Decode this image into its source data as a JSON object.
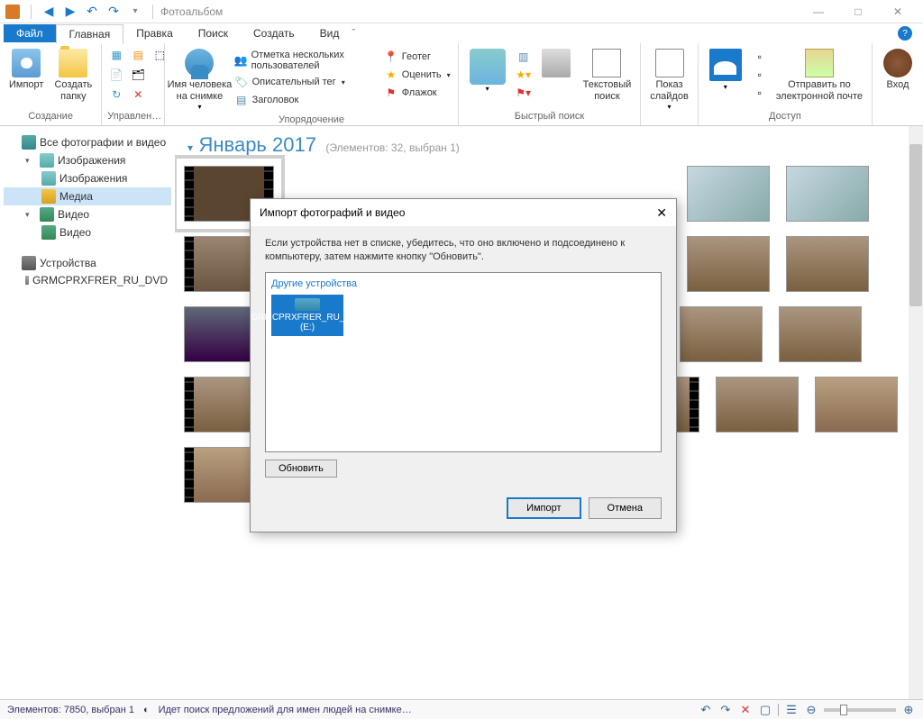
{
  "titlebar": {
    "title": "Фотоальбом"
  },
  "wincontrols": {
    "min": "—",
    "max": "□",
    "close": "✕"
  },
  "menubar": {
    "file": "Файл",
    "tabs": [
      "Главная",
      "Правка",
      "Поиск",
      "Создать",
      "Вид"
    ]
  },
  "ribbon": {
    "g1": {
      "import": "Импорт",
      "create_folder": "Создать\nпапку",
      "label": "Создание"
    },
    "g2": {
      "label": "Управлен…"
    },
    "g3": {
      "person": "Имя человека\nна снимке",
      "label": "Упорядочение",
      "tag_users": "Отметка нескольких пользователей",
      "geotag": "Геотег",
      "desc_tag": "Описательный тег",
      "rate": "Оценить",
      "title_f": "Заголовок",
      "flag": "Флажок"
    },
    "g4": {
      "text_search": "Текстовый\nпоиск",
      "label": "Быстрый поиск"
    },
    "g5": {
      "slideshow": "Показ\nслайдов"
    },
    "g6": {
      "email": "Отправить по\nэлектронной почте",
      "label": "Доступ"
    },
    "g7": {
      "login": "Вход"
    }
  },
  "sidebar": {
    "all": "Все фотографии и видео",
    "images": "Изображения",
    "images2": "Изображения",
    "media": "Медиа",
    "video": "Видео",
    "video2": "Видео",
    "devices": "Устройства",
    "drive": "GRMCPRXFRER_RU_DVD"
  },
  "content": {
    "date": "Январь 2017",
    "count": "(Элементов: 32, выбран 1)"
  },
  "modal": {
    "title": "Импорт фотографий и видео",
    "instr": "Если устройства нет в списке, убедитесь, что оно включено и подсоединено к компьютеру, затем нажмите кнопку \"Обновить\".",
    "group": "Другие устройства",
    "device": "GRMCPRXFRER_RU_DVD (E:)",
    "refresh": "Обновить",
    "import_btn": "Импорт",
    "cancel": "Отмена"
  },
  "statusbar": {
    "count": "Элементов: 7850, выбран 1",
    "searching": "Идет поиск предложений для имен людей на снимке…"
  }
}
